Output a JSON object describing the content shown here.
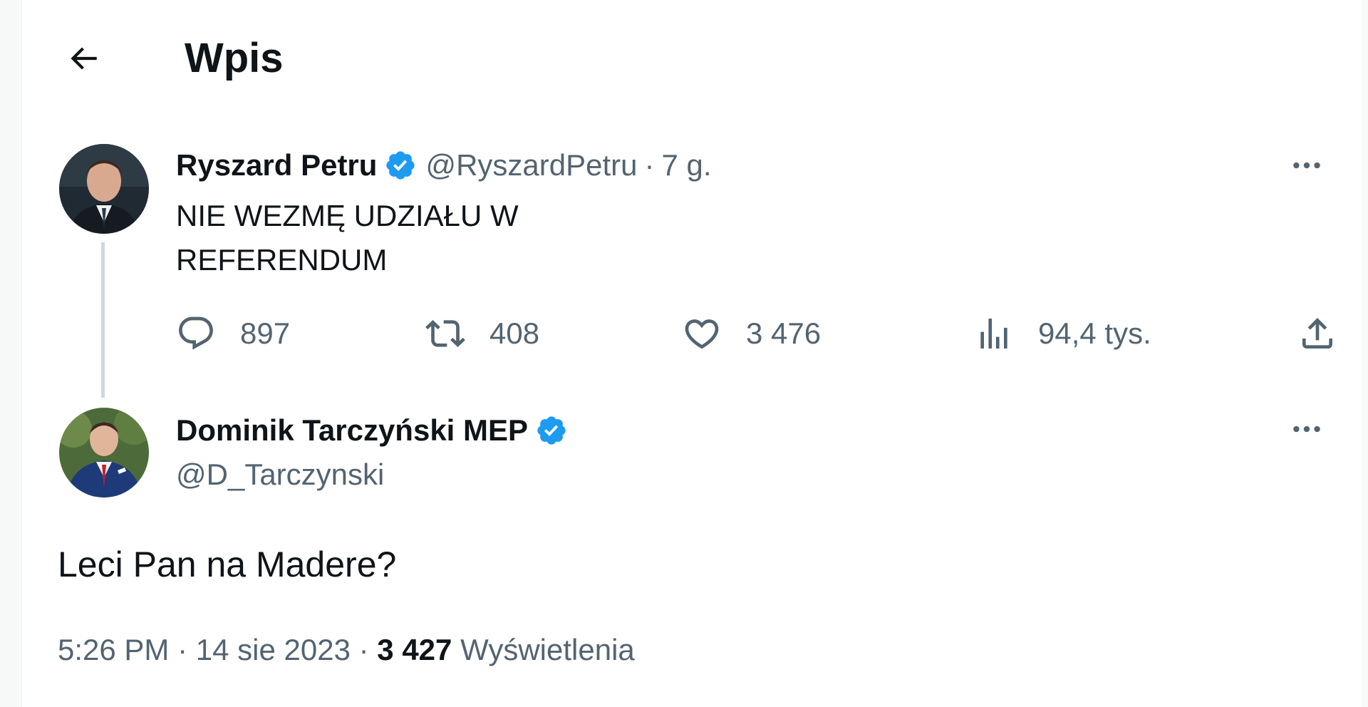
{
  "header": {
    "back_icon": "arrow-left-icon",
    "title": "Wpis"
  },
  "parent_tweet": {
    "display_name": "Ryszard Petru",
    "verified": true,
    "handle": "@RyszardPetru",
    "separator": "·",
    "time": "7 g.",
    "text_line1": "NIE WEZMĘ UDZIAŁU W",
    "text_line2": "REFERENDUM",
    "more_icon": "more-horizontal-icon",
    "actions": {
      "replies": "897",
      "retweets": "408",
      "likes": "3 476",
      "views": "94,4 tys."
    }
  },
  "reply_tweet": {
    "display_name": "Dominik Tarczyński MEP",
    "verified": true,
    "handle": "@D_Tarczynski",
    "more_icon": "more-horizontal-icon",
    "text": "Leci Pan na Madere?",
    "time": "5:26 PM",
    "separator": "·",
    "date": "14 sie 2023",
    "views_count": "3 427",
    "views_label": "Wyświetlenia"
  },
  "colors": {
    "verified_blue": "#1d9bf0",
    "secondary_text": "#536471",
    "primary_text": "#0f1419",
    "thread_line": "#cfd9de"
  }
}
